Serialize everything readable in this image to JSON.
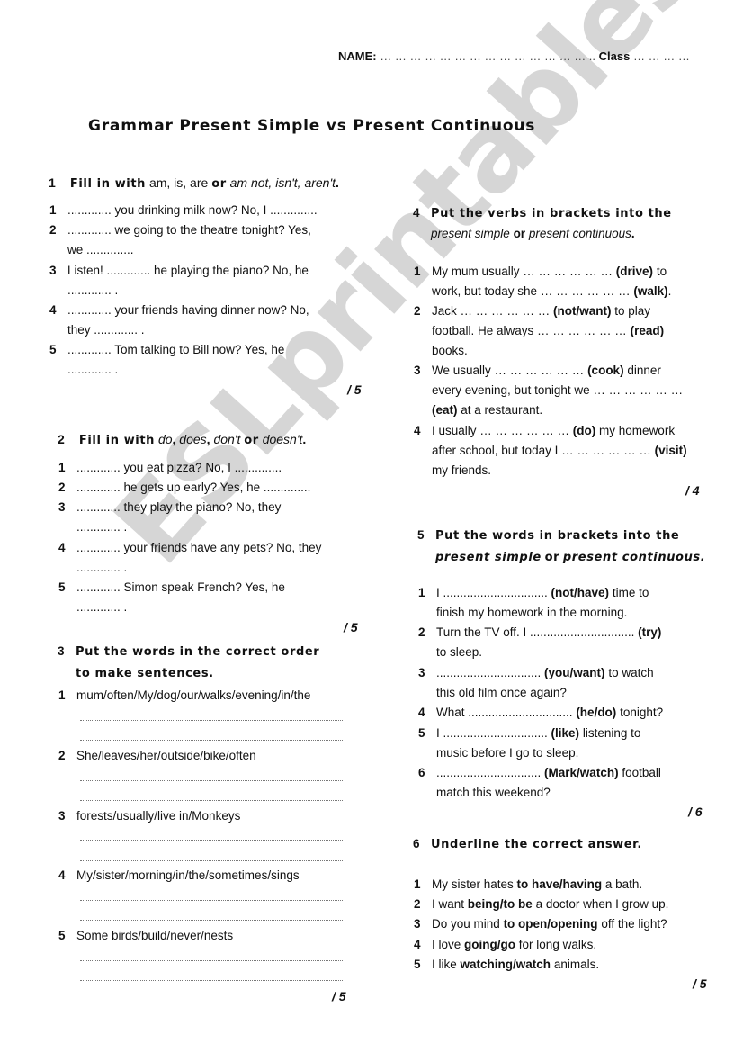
{
  "header": {
    "name_label": "NAME:",
    "name_blank": "… … … … … … … … … … … … … … ..",
    "class_label": "Class",
    "class_blank": "… … … …"
  },
  "title": "Grammar Present Simple vs Present Continuous",
  "watermark": "ESLprintables.com",
  "ex1": {
    "num": "1",
    "instr_bold": "Fill in with",
    "instr_plain": "am, is, are",
    "instr_or": "or",
    "instr_italic": "am not, isn't, aren't",
    "instr_end": ".",
    "items": [
      {
        "n": "1",
        "line1": "............. you drinking milk now? No, I ..............",
        "line2": ""
      },
      {
        "n": "2",
        "line1": "............. we going to the theatre tonight? Yes,",
        "line2": "we .............."
      },
      {
        "n": "3",
        "line1": "Listen! ............. he playing the piano? No, he",
        "line2": "............. ."
      },
      {
        "n": "4",
        "line1": "............. your friends having dinner now? No,",
        "line2": "they ............. ."
      },
      {
        "n": "5",
        "line1": "............. Tom talking to Bill now? Yes, he",
        "line2": "............. ."
      }
    ],
    "score": "/ 5"
  },
  "ex2": {
    "num": "2",
    "instr_bold": "Fill in with",
    "w1": "do",
    "w2": "does",
    "w3": "don't",
    "w4": "doesn't",
    "comma": ",",
    "instr_or": "or",
    "instr_end": ".",
    "items": [
      {
        "n": "1",
        "line1": "............. you eat pizza? No, I ..............",
        "line2": ""
      },
      {
        "n": "2",
        "line1": "............. he gets up early? Yes, he ..............",
        "line2": ""
      },
      {
        "n": "3",
        "line1": "............. they play the piano? No, they",
        "line2": "............. ."
      },
      {
        "n": "4",
        "line1": "............. your friends have any pets? No, they",
        "line2": "............. ."
      },
      {
        "n": "5",
        "line1": "............. Simon speak French? Yes, he",
        "line2": "............. ."
      }
    ],
    "score": "/ 5"
  },
  "ex3": {
    "num": "3",
    "instr_line1": "Put the words in the correct order",
    "instr_line2": "to make sentences.",
    "items": [
      {
        "n": "1",
        "prompt": "mum/often/My/dog/our/walks/evening/in/the"
      },
      {
        "n": "2",
        "prompt": "She/leaves/her/outside/bike/often"
      },
      {
        "n": "3",
        "prompt": "forests/usually/live in/Monkeys"
      },
      {
        "n": "4",
        "prompt": "My/sister/morning/in/the/sometimes/sings"
      },
      {
        "n": "5",
        "prompt": "Some birds/build/never/nests"
      }
    ],
    "score": "/ 5"
  },
  "ex4": {
    "num": "4",
    "instr_line1": "Put the verbs in brackets into the",
    "instr_it1": "present simple",
    "instr_or": "or",
    "instr_it2": "present continuous",
    "instr_end": ".",
    "items": [
      {
        "n": "1",
        "l1a": "My mum usually … … … … … …",
        "l1b": "(drive)",
        "l1c": "to",
        "l2a": "work, but today she … … … … … …",
        "l2b": "(walk)",
        "l2c": ".",
        "l3a": "",
        "l3b": "",
        "l3c": ""
      },
      {
        "n": "2",
        "l1a": "Jack … … … … … …",
        "l1b": "(not/want)",
        "l1c": "to play",
        "l2a": "football. He always  … … … … … …",
        "l2b": "(read)",
        "l2c": "",
        "l3a": "books.",
        "l3b": "",
        "l3c": ""
      },
      {
        "n": "3",
        "l1a": "We usually … … … … … …",
        "l1b": "(cook)",
        "l1c": "dinner",
        "l2a": "every evening, but tonight we … … … … … …",
        "l2b": "",
        "l2c": "",
        "l3a": "",
        "l3b": "(eat)",
        "l3c": "at a restaurant."
      },
      {
        "n": "4",
        "l1a": "I usually … … … … … …",
        "l1b": "(do)",
        "l1c": "my homework",
        "l2a": "after school, but today I … … … … … …",
        "l2b": "(visit)",
        "l2c": "",
        "l3a": "my friends.",
        "l3b": "",
        "l3c": ""
      }
    ],
    "score": "/ 4"
  },
  "ex5": {
    "num": "5",
    "instr_line1": "Put the words in brackets into the",
    "instr_it1": "present simple",
    "instr_or": "or",
    "instr_it2": "present continuous.",
    "items": [
      {
        "n": "1",
        "a": "I ...............................",
        "b": "(not/have)",
        "c": "time to",
        "line2": "finish my homework in the morning."
      },
      {
        "n": "2",
        "a": "Turn the TV off. I ...............................",
        "b": "(try)",
        "c": "",
        "line2": "to sleep."
      },
      {
        "n": "3",
        "a": "...............................",
        "b": "(you/want)",
        "c": "to watch",
        "line2": "this old film once again?"
      },
      {
        "n": "4",
        "a": "What ...............................",
        "b": "(he/do)",
        "c": "tonight?",
        "line2": ""
      },
      {
        "n": "5",
        "a": "I ...............................",
        "b": "(like)",
        "c": "listening to",
        "line2": "music before I go to sleep."
      },
      {
        "n": "6",
        "a": "...............................",
        "b": "(Mark/watch)",
        "c": "football",
        "line2": "match this weekend?"
      }
    ],
    "score": "/ 6"
  },
  "ex6": {
    "num": "6",
    "instr": "Underline the correct answer.",
    "items": [
      {
        "n": "1",
        "a": "My sister hates",
        "b": "to have/having",
        "c": "a bath."
      },
      {
        "n": "2",
        "a": "I want",
        "b": "being/to be",
        "c": "a doctor when I grow up."
      },
      {
        "n": "3",
        "a": "Do you mind",
        "b": "to open/opening",
        "c": "off the light?"
      },
      {
        "n": "4",
        "a": "I love",
        "b": "going/go",
        "c": "for long walks."
      },
      {
        "n": "5",
        "a": "I like",
        "b": "watching/watch",
        "c": "animals."
      }
    ],
    "score": "/ 5"
  }
}
